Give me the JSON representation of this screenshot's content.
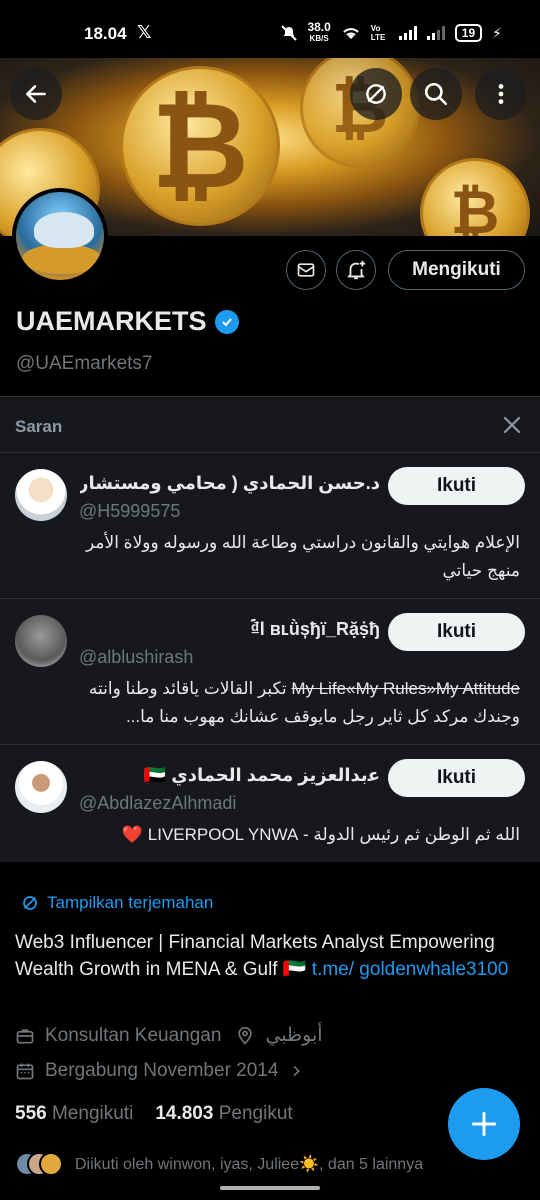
{
  "status_bar": {
    "time": "18.04",
    "x_logo": "𝕏",
    "net_speed": "38.0",
    "net_unit": "KB/S",
    "volte": "Vo LTE",
    "battery": "19"
  },
  "profile": {
    "name": "UAEMARKETS",
    "handle": "@UAEmarkets7",
    "follow_button": "Mengikuti",
    "translate_link": "Tampilkan terjemahan",
    "bio_text": "Web3 Influencer | Financial Markets Analyst Empowering Wealth Growth in MENA & Gulf 🇦🇪 ",
    "bio_link": "t.me/ goldenwhale3100",
    "category": "Konsultan Keuangan",
    "location": "أبوظبي",
    "joined": "Bergabung November 2014",
    "following_count": "556",
    "following_label": "Mengikuti",
    "followers_count": "14.803",
    "followers_label": "Pengikut",
    "followed_by": "Diikuti oleh winwon, iyas, Juliee☀️, dan 5 lainnya"
  },
  "suggestions": {
    "title": "Saran",
    "items": [
      {
        "name": "د.حسن الحمادي ( محامي ومستشار قا...",
        "handle": "@H5999575",
        "bio": "الإعلام هوايتي والقانون دراستي وطاعة الله ورسوله وولاة الأمر منهج حياتي",
        "button": "Ikuti"
      },
      {
        "name": "ؐ₫l ʙʟǜșђї_Rặṩђ",
        "handle": "@alblushirash",
        "bio_strike": "My Life«My Rules»My Attitude",
        "bio_rest": "تكبر القالات ياقائد وطنا وانته وجندك مركد كل ثاير رجل مايوقف عشانك مهوب منا ما...",
        "button": "Ikuti"
      },
      {
        "name": "ﻋبدالعزيز محمد الحمادي 🇦🇪",
        "handle": "@AbdlazezAlhmadi",
        "bio": "الله ثم الوطن ثم رئيس الدولة - LIVERPOOL YNWA ❤️",
        "button": "Ikuti"
      }
    ]
  },
  "colors": {
    "accent": "#1d9bf0",
    "background": "#000000",
    "muted": "#71767b"
  }
}
